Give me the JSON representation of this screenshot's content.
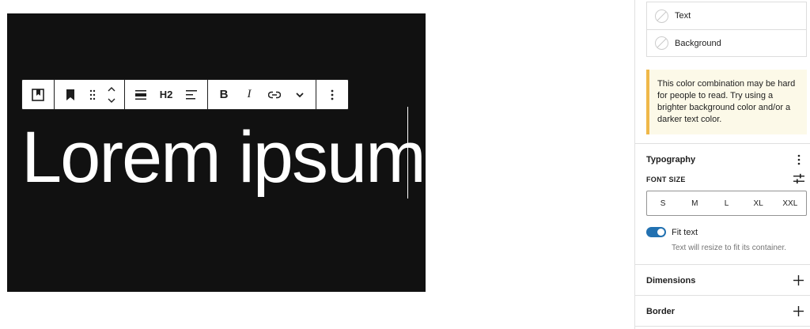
{
  "canvas": {
    "heading_text": "Lorem ipsum"
  },
  "toolbar": {
    "heading_level": "H2",
    "buttons": [
      "pattern-icon",
      "bookmark-icon",
      "drag-handle-icon",
      "move-up-icon",
      "move-down-icon",
      "align-icon",
      "heading-level",
      "text-align-icon",
      "bold-icon",
      "italic-icon",
      "link-icon",
      "more-rich-text-icon",
      "options-icon"
    ]
  },
  "sidebar": {
    "colors": {
      "items": [
        {
          "label": "Text"
        },
        {
          "label": "Background"
        }
      ]
    },
    "notice": "This color combination may be hard for people to read. Try using a brighter background color and/or a darker text color.",
    "typography": {
      "title": "Typography",
      "font_size_label": "FONT SIZE",
      "sizes": [
        "S",
        "M",
        "L",
        "XL",
        "XXL"
      ],
      "fit_text": {
        "label": "Fit text",
        "enabled": true,
        "help": "Text will resize to fit its container."
      }
    },
    "dimensions": {
      "title": "Dimensions"
    },
    "border": {
      "title": "Border"
    }
  },
  "colors": {
    "canvas_bg": "#111111",
    "heading_color": "#ffffff",
    "notice_border": "#f0b849",
    "notice_bg": "#fcf9e8",
    "toggle_on": "#2271b1"
  }
}
